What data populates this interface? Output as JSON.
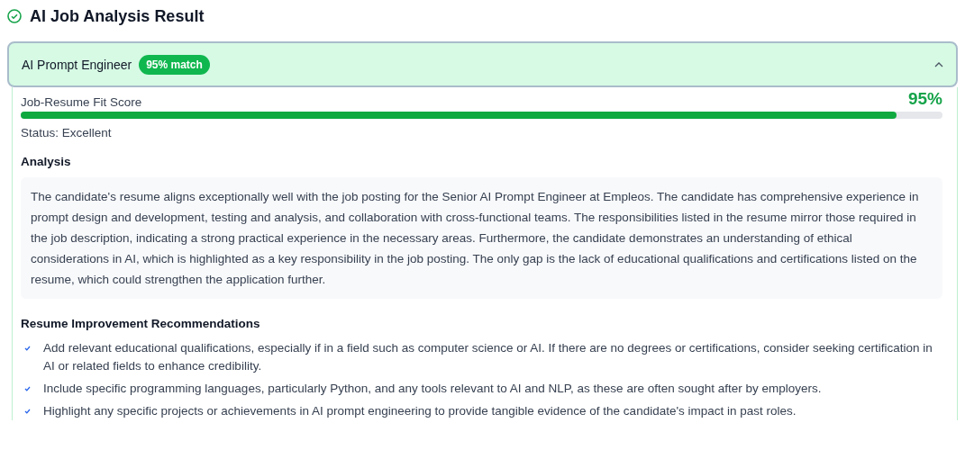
{
  "title": "AI Job Analysis Result",
  "job": {
    "name": "AI Prompt Engineer",
    "badge": "95% match",
    "expanded": true
  },
  "fit": {
    "label": "Job-Resume Fit Score",
    "score": "95%",
    "level": 0.95,
    "status": "Status: Excellent"
  },
  "analysis": {
    "heading": "Analysis",
    "text": "The candidate's resume aligns exceptionally well with the job posting for the Senior AI Prompt Engineer at Empleos. The candidate has comprehensive experience in prompt design and development, testing and analysis, and collaboration with cross-functional teams. The responsibilities listed in the resume mirror those required in the job description, indicating a strong practical experience in the necessary areas. Furthermore, the candidate demonstrates an understanding of ethical considerations in AI, which is highlighted as a key responsibility in the job posting. The only gap is the lack of educational qualifications and certifications listed on the resume, which could strengthen the application further."
  },
  "recommendations": {
    "heading": "Resume Improvement Recommendations",
    "items": [
      "Add relevant educational qualifications, especially if in a field such as computer science or AI. If there are no degrees or certifications, consider seeking certification in AI or related fields to enhance credibility.",
      "Include specific programming languages, particularly Python, and any tools relevant to AI and NLP, as these are often sought after by employers.",
      "Highlight any specific projects or achievements in AI prompt engineering to provide tangible evidence of the candidate's impact in past roles."
    ]
  }
}
